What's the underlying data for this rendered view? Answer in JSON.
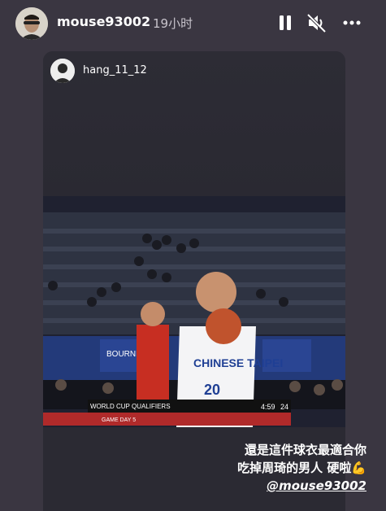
{
  "header": {
    "username": "mouse93002",
    "time_ago": "19小时"
  },
  "post": {
    "username": "hang_11_12",
    "caption_line1": "還是這件球衣最適合你",
    "caption_line2": "吃掉周琦的男人 硬啦💪",
    "mention": "@mouse93002"
  },
  "video": {
    "scoreboard_label": "WORLD CUP QUALIFIERS",
    "scoreboard_subtitle": "GAME DAY 5",
    "scoreboard_clock": "4:59",
    "scoreboard_shotclock": "24",
    "jersey_text": "CHINESE TAIPEI",
    "jersey_number": "20",
    "banner_text": "BOURNE"
  }
}
